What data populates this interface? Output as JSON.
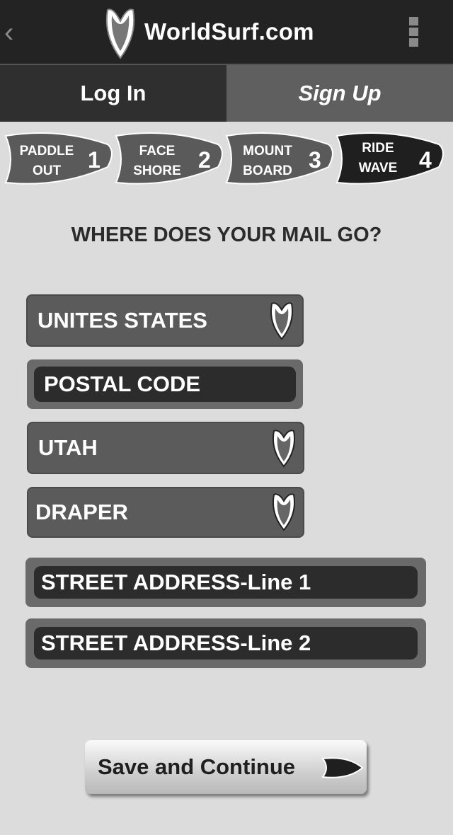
{
  "header": {
    "brand": "WorldSurf.com",
    "back_icon": "chevron-left-icon",
    "menu_icon": "vertical-menu-icon",
    "logo_icon": "surfboard-logo-icon"
  },
  "tabs": [
    {
      "label": "Log In",
      "active": false
    },
    {
      "label": "Sign Up",
      "active": true
    }
  ],
  "steps": [
    {
      "line1": "PADDLE",
      "line2": "OUT",
      "number": "1",
      "active": false
    },
    {
      "line1": "FACE",
      "line2": "SHORE",
      "number": "2",
      "active": false
    },
    {
      "line1": "MOUNT",
      "line2": "BOARD",
      "number": "3",
      "active": false
    },
    {
      "line1": "RIDE",
      "line2": "WAVE",
      "number": "4",
      "active": true
    }
  ],
  "form": {
    "heading": "WHERE DOES YOUR MAIL GO?",
    "country": "UNITES STATES",
    "postal_code": "POSTAL CODE",
    "state": "UTAH",
    "city": "DRAPER",
    "street1": "STREET ADDRESS-Line 1",
    "street2": "STREET ADDRESS-Line 2"
  },
  "save_button": {
    "label": "Save and Continue",
    "icon": "surfboard-arrow-icon"
  },
  "colors": {
    "topbar": "#232323",
    "tab_inactive": "#2f2f2f",
    "tab_active": "#5f5f5f",
    "background": "#dcdcdc",
    "step_inactive": "#5a5a5a",
    "step_active": "#1f1f1f"
  }
}
